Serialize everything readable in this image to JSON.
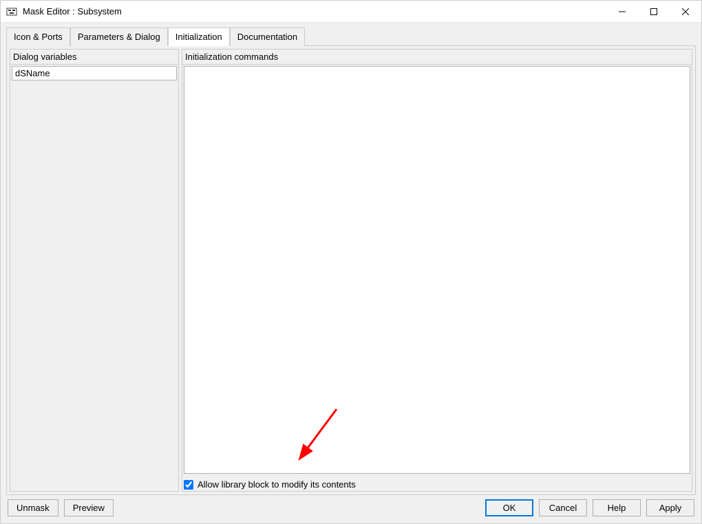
{
  "window": {
    "title": "Mask Editor : Subsystem"
  },
  "tabs": {
    "icon_ports": "Icon & Ports",
    "params_dialog": "Parameters & Dialog",
    "initialization": "Initialization",
    "documentation": "Documentation"
  },
  "panels": {
    "dialog_vars_label": "Dialog variables",
    "init_cmds_label": "Initialization commands",
    "dialog_vars": {
      "item0": "dSName"
    },
    "init_commands_value": ""
  },
  "checkbox": {
    "allow_library_label": "Allow library block to modify its contents",
    "checked": true
  },
  "buttons": {
    "unmask": "Unmask",
    "preview": "Preview",
    "ok": "OK",
    "cancel": "Cancel",
    "help": "Help",
    "apply": "Apply"
  }
}
